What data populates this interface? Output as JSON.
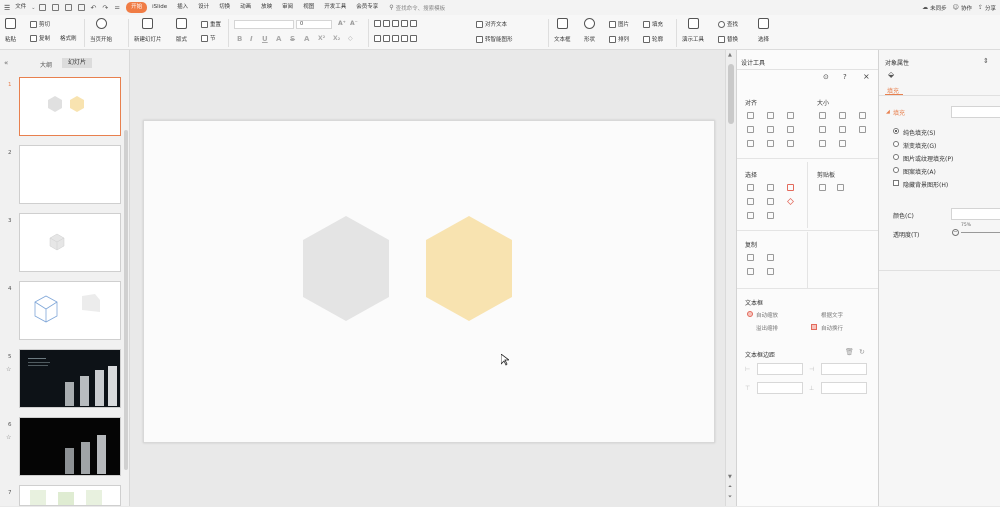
{
  "menubar": {
    "file_label": "文件",
    "tabs": [
      "开始",
      "iSlide",
      "插入",
      "设计",
      "切换",
      "动画",
      "放映",
      "审阅",
      "视图",
      "开发工具",
      "会员专享"
    ],
    "active_tab": "开始",
    "search_placeholder": "查找命令、搜索模板",
    "sync_label": "未同步",
    "collab_label": "协作",
    "share_label": "分享"
  },
  "ribbon": {
    "paste": "粘贴",
    "cut": "剪切",
    "copy": "复制",
    "format_painter": "格式刷",
    "play_from_current": "当页开始",
    "new_slide": "新建幻灯片",
    "layout": "版式",
    "section": "节",
    "reset": "重置",
    "font_size_value": "0",
    "text_box": "文本框",
    "shape": "形状",
    "arrange": "排列",
    "picture": "图片",
    "fill": "填充",
    "outline": "轮廓",
    "present_tools": "演示工具",
    "find": "查找",
    "replace": "替换",
    "select": "选择",
    "align_text": "对齐文本",
    "convert_to_smartart": "转智能图形"
  },
  "left_panel": {
    "tab_outline": "大纲",
    "tab_slides": "幻灯片",
    "slide_numbers": [
      "1",
      "2",
      "3",
      "4",
      "5",
      "6",
      "7"
    ],
    "star": "☆"
  },
  "design_panel": {
    "title": "设计工具",
    "align": "对齐",
    "size": "大小",
    "select": "选择",
    "clipboard": "剪贴板",
    "copy": "复制",
    "textbox": "文本框",
    "auto_fit": "自动缩放",
    "shrink_overflow": "溢出缩排",
    "wrap_text": "根据文字",
    "auto_wrap": "自动换行",
    "margins": "文本框边距"
  },
  "prop_panel": {
    "title": "对象属性",
    "fill_tab": "填充",
    "fill_section": "填充",
    "solid_fill": "纯色填充(S)",
    "gradient_fill": "渐变填充(G)",
    "picture_fill": "图片或纹理填充(P)",
    "pattern_fill": "图案填充(A)",
    "hide_background": "隐藏背景图形(H)",
    "color_label": "颜色(C)",
    "transparency_label": "透明度(T)",
    "transparency_value": "75%"
  },
  "colors": {
    "accent": "#f07c45",
    "hexagon_gray": "#e4e4e4",
    "hexagon_yellow": "#f8e3b0",
    "selected_border": "#e8804e"
  }
}
